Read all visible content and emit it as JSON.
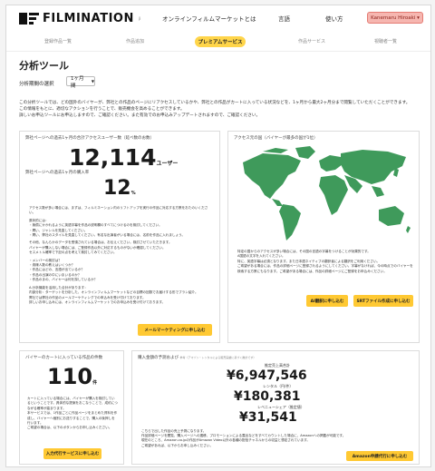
{
  "header": {
    "logo_text": "FILMINATION",
    "logo_sub": "β",
    "nav": [
      "オンラインフィルムマーケットとは",
      "言語",
      "使い方"
    ],
    "user_label": "Kanemaru Hiroaki ▾"
  },
  "subnav": {
    "items": [
      "登録作品一覧",
      "作品追加",
      "作品サービス",
      "視聴者一覧"
    ],
    "active": "プレミアムサービス"
  },
  "page": {
    "title": "分析ツール",
    "period_label": "分析期間の選択",
    "period_value": "1ヶ月間",
    "description": [
      "この分析ツールでは、どの国外のバイヤーが、弊社との作品のページにリアクセスしているかや、弊社との作品がカートに入っている状況などを、1ヶ月から最大2ヶ月分まで閲覧していただくことができます。",
      "この情報をもとに、適切なアクションを行うことで、販売機会を高めることができます。",
      "詳しいお申込ツールにお申込しますので、ご確認ください。また有効でのお申込みアップデートされますので、ご確認ください。"
    ]
  },
  "card_visits": {
    "header": "弊社ページへの過去1ヶ月の合計アクセスユーザー数（延べ数のお数）",
    "value": "12,114",
    "unit": "ユーザー",
    "sub_label": "弊社ページへの過去1ヶ月の購入率",
    "sub_value": "12",
    "sub_unit": "%",
    "body": [
      "アクセス数が多い場合には、まずは、フィルミネーション内のリフトアップを実行の作品に対応する方策をおたのいください。",
      "原状的には：",
      "・無償にかかれるように英語字幕を作品の説明欄のすべてにつけるのを検討してください。",
      "・問い、ジャンルを見直してください。",
      "・問い、弊社のスタイルを見直してください。有名な出演者がいる場合には、名前を作品に入れましょう。",
      "その他、なんらかのデータを受領されている場合は、お伝えください。検討させていただきます。",
      "バイヤーが購入しない場合には、ご登録作品以外に対応するものがないか確認してください。",
      "セスメトル確率で下記の点を考えて検討してみてください。",
      "・メンバーの検討は？",
      "・貴様人数の教えはいくつか？",
      "・作品にはどの、言語が出ているか？",
      "・作品の出演の中にいまいるのか？",
      "・作品のまの、バイヤーは何を探しているか？",
      "A-分析機能を活用した合計があります：",
      "内部分析：ターゲットを分析した、オンラインフィルムマーケットなどの目標の回数でお届けする形でプラン紹介。",
      "弊社では弊社の作品のメールマーケティングでの申込みを受け付けております。",
      "詳しいお申し込みには、オンラインフィルムマーケットでのお申込みを受け付けております。"
    ],
    "button": "メールマーケティングに申し込む"
  },
  "card_map": {
    "header": "アクセス元の国（バイヤーが最多の国が1位）",
    "body": [
      "特定の国からのアクセスが多い場合には、その国の言語の字幕をつけることが効果的です。",
      "A国語の文字を入れてください。",
      "特に、英語字幕は必須となります。また日本語ネイティブの翻訳者による翻訳をご利用ください。",
      "ご希望がある場合には、作品の詳細ページに登録されるようにしてください。字幕がなければ、今の時点でのバイヤーを検索する方策にもなります。ご希望がある場合には、作品の詳細ページにご登録をお申込みください。"
    ],
    "button_1": "AI翻訳に申し込む",
    "button_2": "SRTファイル作成に申し込む"
  },
  "card_cart": {
    "header": "バイヤーのカートに入っている作品の件数",
    "value": "110",
    "unit": "件",
    "body": [
      "カートに入っている場合には、バイヤーが購入を検討しているということです。具体的な提案をおこなうことで、成約につながる確率が高まります。",
      "本サービスでは、1作品ごとに作品ページをまとめた資料を作成し、バイヤーへ個別にお送りすることで、購入の後押しを行います。",
      "ご希望の場合は、以下のボタンからお申し込みください。"
    ],
    "button": "入力代行サービスに申し込む"
  },
  "card_revenue": {
    "header": "購入金額の予測および",
    "header_note": "参考（アマゾン・レンタルによる販売実績に基づく推計です）",
    "estimate_label": "推定売上高合計",
    "estimate_value": "¥6,947,546",
    "rental_label": "レンタル（円/件）",
    "rental_value": "¥180,381",
    "share_label": "レベニューシェア（推定値）",
    "share_value": "¥31,541",
    "body": [
      "こちらで出した作品の売上予測になります。",
      "作品詳細ページを閲覧、購入ページへの遷移、プロモーションによる露出などをすべてカウントした場合に、Amazonへの掲載が可能です。",
      "現在のところ、Amazon.co.jpの作品がAmazon Video以外の各種の配信チャネルからの収益と想定されています。",
      "ご希望があれば、以下からお申し込みください。"
    ],
    "button": "Amazon申請代行に申し込む"
  },
  "colors": {
    "accent_yellow": "#ffc933",
    "map_green": "#3f9a5b",
    "user_badge": "#f6b6b0"
  }
}
